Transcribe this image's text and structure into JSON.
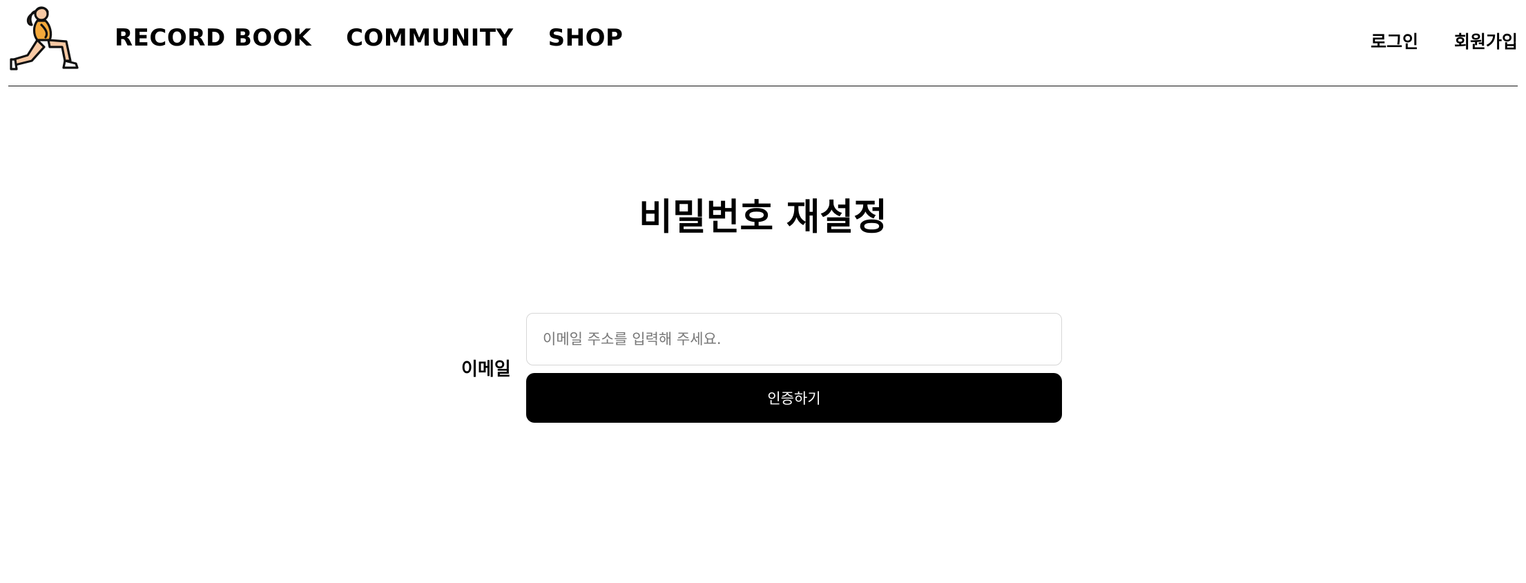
{
  "header": {
    "logo_icon": "lunge-exercise-person-icon",
    "nav": [
      {
        "label": "RECORD BOOK"
      },
      {
        "label": "COMMUNITY"
      },
      {
        "label": "SHOP"
      }
    ],
    "auth": {
      "login_label": "로그인",
      "signup_label": "회원가입"
    }
  },
  "main": {
    "title": "비밀번호 재설정",
    "email_label": "이메일",
    "email_input": {
      "value": "",
      "placeholder": "이메일 주소를 입력해 주세요."
    },
    "verify_button_label": "인증하기"
  },
  "colors": {
    "text": "#000000",
    "button_bg": "#000000",
    "button_text": "#ffffff",
    "input_border": "#d6d6d6",
    "placeholder": "#777777",
    "logo_skin": "#f7c9a4",
    "logo_outfit": "#f4a93b"
  }
}
